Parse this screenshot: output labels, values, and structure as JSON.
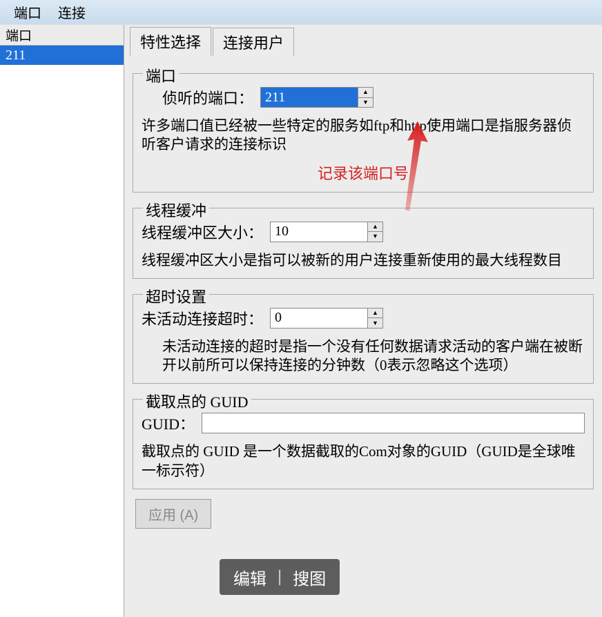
{
  "menubar": {
    "items": [
      "端口",
      "连接"
    ]
  },
  "sidebar": {
    "header": "端口",
    "items": [
      "211"
    ]
  },
  "tabs": {
    "items": [
      "特性选择",
      "连接用户"
    ],
    "active": 0
  },
  "groups": {
    "port": {
      "legend": "端口",
      "label": "侦听的端口：",
      "value": "211",
      "desc": "许多端口值已经被一些特定的服务如ftp和http使用端口是指服务器侦听客户请求的连接标识",
      "annotation": "记录该端口号"
    },
    "buffer": {
      "legend": "线程缓冲",
      "label": "线程缓冲区大小：",
      "value": "10",
      "desc": "线程缓冲区大小是指可以被新的用户连接重新使用的最大线程数目"
    },
    "timeout": {
      "legend": "超时设置",
      "label": "未活动连接超时：",
      "value": "0",
      "desc": "未活动连接的超时是指一个没有任何数据请求活动的客户端在被断开以前所可以保持连接的分钟数（0表示忽略这个选项）"
    },
    "guid": {
      "legend": "截取点的 GUID",
      "label": "GUID：",
      "value": "",
      "desc": "截取点的 GUID 是一个数据截取的Com对象的GUID（GUID是全球唯一标示符）"
    }
  },
  "buttons": {
    "apply": "应用 (A)"
  },
  "floating_toolbar": {
    "edit": "编辑",
    "search": "搜图",
    "divider": "|"
  }
}
